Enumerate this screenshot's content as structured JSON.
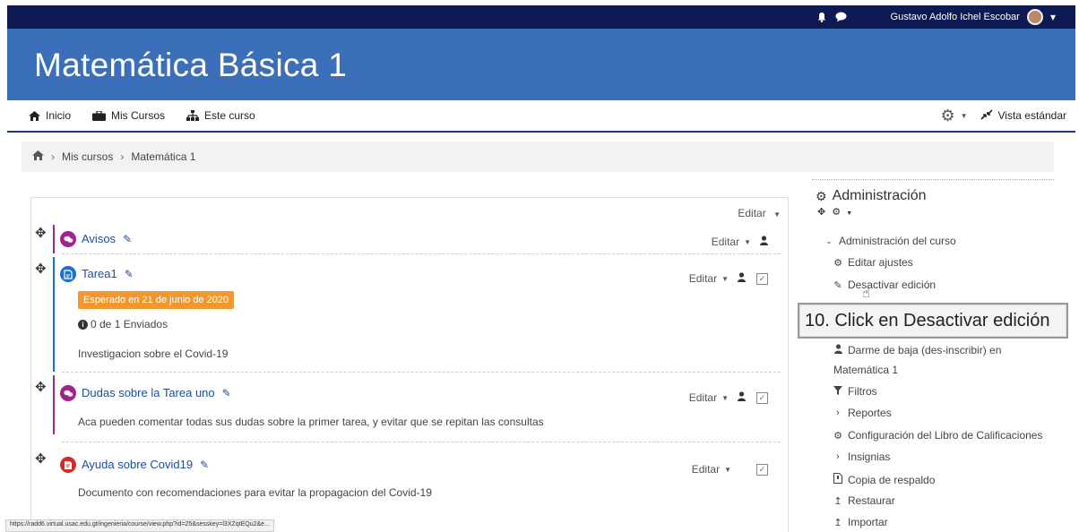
{
  "topbar": {
    "user_name": "Gustavo Adolfo Ichel Escobar",
    "bell_icon": "bell-icon",
    "chat_icon": "chat-icon"
  },
  "banner": {
    "title": "Matemática Básica 1"
  },
  "nav": {
    "inicio": "Inicio",
    "mis_cursos": "Mis Cursos",
    "este_curso": "Este curso",
    "vista": "Vista estándar"
  },
  "breadcrumb": {
    "level1": "Mis cursos",
    "level2": "Matemática 1"
  },
  "main": {
    "editar_top": "Editar",
    "activities": [
      {
        "title": "Avisos",
        "edit": "Editar",
        "color": "#a2238f"
      },
      {
        "title": "Tarea1",
        "edit": "Editar",
        "color": "#1e6fd0",
        "due": "Esperado en 21 de junio de 2020",
        "submitted": "0 de 1 Enviados",
        "desc": "Investigacion sobre el Covid-19"
      },
      {
        "title": "Dudas sobre la Tarea uno",
        "edit": "Editar",
        "color": "#a2238f",
        "desc": "Aca pueden comentar todas sus dudas sobre la primer tarea, y evitar que se repitan las consultas"
      },
      {
        "title": "Ayuda sobre Covid19",
        "edit": "Editar",
        "color": "#d12b2b",
        "desc": "Documento con recomendaciones para evitar la propagacion del Covid-19"
      }
    ]
  },
  "sidebar": {
    "heading": "Administración",
    "section": "Administración del curso",
    "items": [
      "Editar ajustes",
      "Desactivar edición",
      "Darme de baja (des-inscribir) en",
      "Matemática 1",
      "Filtros",
      "Reportes",
      "Configuración del Libro de Calificaciones",
      "Insignias",
      "Copia de respaldo",
      "Restaurar",
      "Importar"
    ]
  },
  "callout": {
    "text": "10. Click en Desactivar edición"
  },
  "statusbar": {
    "url": "https://radd6.virtual.usac.edu.gt/ingenieria/course/view.php?id=25&sesskey=l3XZqtEQu2&e..."
  },
  "colors": {
    "topbar": "#0f1a52",
    "banner": "#3b6fb9",
    "link": "#1c4ea0",
    "due_badge": "#f0972d"
  }
}
